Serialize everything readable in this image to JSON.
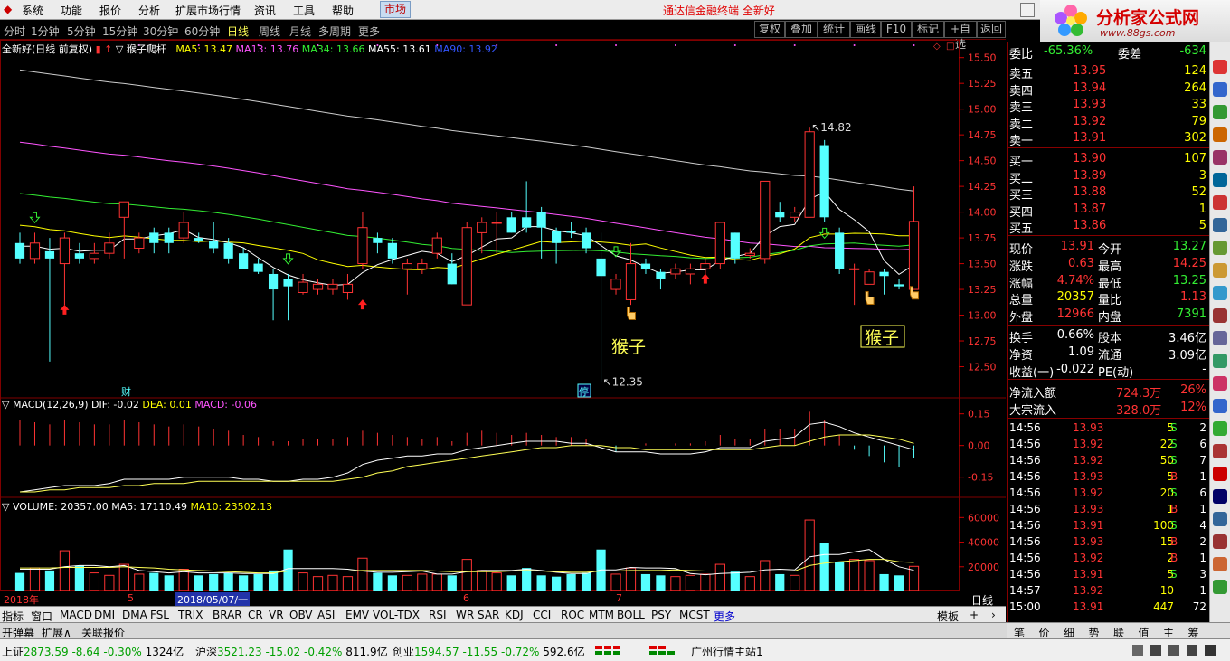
{
  "menubar": {
    "items": [
      "系统",
      "功能",
      "报价",
      "分析",
      "扩展市场行情",
      "资讯",
      "工具",
      "帮助"
    ],
    "market_button": "市场",
    "center_title": "通达信金融终端  全新好",
    "logo_title": "分析家公式网",
    "logo_url": "www.88gs.com"
  },
  "toolbar": {
    "periods": [
      "分时",
      "1分钟",
      "5分钟",
      "15分钟",
      "30分钟",
      "60分钟",
      "日线",
      "周线",
      "月线",
      "多周期",
      "更多"
    ],
    "active_period": "日线",
    "right_buttons": [
      "复权",
      "叠加",
      "统计",
      "画线",
      "F10",
      "标记",
      "+自选",
      "返回"
    ]
  },
  "legend": {
    "stock": "全新好(日线 前复权)",
    "indicator": "猴子爬杆",
    "ma5": "MA5: 13.47",
    "ma13": "MA13: 13.76",
    "ma34": "MA34: 13.66",
    "ma55": "MA55: 13.61",
    "ma90": "MA90: 13.92"
  },
  "macd_legend": {
    "name": "MACD(12,26,9)",
    "dif": "DIF: -0.02",
    "dea": "DEA: 0.01",
    "macd": "MACD: -0.06"
  },
  "vol_legend": {
    "name": "VOLUME: 20357.00",
    "ma5": "MA5: 17110.49",
    "ma10": "MA10: 23502.13"
  },
  "annotations": {
    "high_label": "14.82",
    "low_label": "12.35",
    "monkey1": "猴子",
    "monkey2": "猴子",
    "cai": "财",
    "ting": "停"
  },
  "colors": {
    "up": "#ff3333",
    "down": "#55ffff",
    "ma5": "#ffffff",
    "ma13": "#ffff00",
    "ma34": "#33ee33",
    "ma55": "#ff55ff",
    "ma90": "#cccccc",
    "grid": "#800000"
  },
  "chart_data": {
    "type": "candlestick",
    "price_axis": {
      "ylim": [
        12.25,
        15.55
      ],
      "ticks": [
        "15.50",
        "15.25",
        "15.00",
        "14.75",
        "14.50",
        "14.25",
        "14.00",
        "13.75",
        "13.50",
        "13.25",
        "13.00",
        "12.75",
        "12.50"
      ]
    },
    "macd_axis": {
      "ylim": [
        -0.22,
        0.2
      ],
      "ticks": [
        "0.15",
        "0.00",
        "-0.15"
      ]
    },
    "volume_axis": {
      "ylim": [
        0,
        72000
      ],
      "ticks": [
        "60000",
        "40000",
        "20000"
      ]
    },
    "date_labels": [
      "2018年",
      "5",
      "2018/05/07/一",
      "6",
      "7"
    ],
    "candles": [
      [
        13.7,
        13.55,
        13.8,
        13.5
      ],
      [
        13.55,
        13.7,
        13.8,
        13.5
      ],
      [
        13.62,
        13.55,
        13.75,
        12.55
      ],
      [
        13.5,
        13.75,
        13.8,
        13.1
      ],
      [
        13.6,
        13.55,
        13.7,
        13.5
      ],
      [
        13.55,
        13.6,
        13.7,
        13.5
      ],
      [
        13.6,
        13.7,
        13.8,
        13.55
      ],
      [
        13.95,
        14.1,
        14.1,
        13.55
      ],
      [
        13.65,
        13.75,
        13.8,
        13.6
      ],
      [
        13.8,
        13.7,
        13.85,
        13.6
      ],
      [
        13.8,
        13.7,
        13.85,
        13.6
      ],
      [
        13.75,
        13.9,
        14.0,
        13.7
      ],
      [
        13.75,
        13.72,
        13.8,
        13.7
      ],
      [
        13.72,
        13.65,
        13.9,
        13.6
      ],
      [
        13.7,
        13.55,
        13.75,
        13.5
      ],
      [
        13.6,
        13.45,
        13.65,
        13.45
      ],
      [
        13.5,
        13.42,
        13.55,
        13.4
      ],
      [
        13.4,
        13.25,
        13.45,
        12.95
      ],
      [
        13.35,
        13.28,
        13.4,
        12.95
      ],
      [
        13.22,
        13.32,
        13.4,
        13.2
      ],
      [
        13.25,
        13.3,
        13.35,
        13.2
      ],
      [
        13.25,
        13.3,
        13.35,
        13.2
      ],
      [
        13.22,
        13.3,
        13.4,
        13.15
      ],
      [
        13.5,
        13.85,
        14.0,
        13.45
      ],
      [
        13.75,
        13.7,
        13.8,
        13.6
      ],
      [
        13.7,
        13.55,
        13.75,
        13.5
      ],
      [
        13.45,
        13.5,
        13.55,
        13.2
      ],
      [
        13.45,
        13.5,
        13.55,
        13.4
      ],
      [
        13.6,
        13.75,
        13.8,
        13.55
      ],
      [
        13.5,
        13.3,
        13.6,
        13.3
      ],
      [
        13.1,
        13.85,
        13.9,
        13.1
      ],
      [
        13.8,
        13.9,
        13.95,
        13.6
      ],
      [
        13.9,
        13.9,
        14.0,
        13.6
      ],
      [
        13.95,
        13.8,
        14.0,
        13.8
      ],
      [
        13.95,
        13.85,
        14.3,
        13.8
      ],
      [
        14.0,
        13.85,
        14.05,
        13.55
      ],
      [
        13.82,
        13.7,
        13.85,
        13.5
      ],
      [
        13.82,
        13.8,
        13.9,
        13.75
      ],
      [
        13.8,
        13.65,
        13.85,
        13.6
      ],
      [
        13.55,
        13.38,
        13.8,
        12.35
      ],
      [
        13.25,
        13.35,
        13.4,
        13.2
      ],
      [
        13.15,
        13.5,
        13.7,
        13.1
      ],
      [
        13.5,
        13.45,
        13.55,
        13.4
      ],
      [
        13.42,
        13.35,
        13.45,
        13.25
      ],
      [
        13.4,
        13.45,
        13.5,
        13.35
      ],
      [
        13.4,
        13.45,
        13.5,
        13.3
      ],
      [
        13.45,
        13.5,
        13.55,
        13.4
      ],
      [
        13.5,
        13.9,
        13.9,
        13.45
      ],
      [
        13.8,
        13.55,
        13.8,
        13.5
      ],
      [
        13.58,
        13.6,
        13.65,
        13.55
      ],
      [
        13.55,
        14.3,
        14.3,
        13.5
      ],
      [
        14.0,
        13.95,
        14.1,
        13.9
      ],
      [
        13.95,
        14.0,
        14.05,
        13.9
      ],
      [
        13.95,
        14.78,
        14.82,
        13.95
      ],
      [
        14.65,
        13.95,
        14.7,
        13.9
      ],
      [
        13.8,
        13.45,
        13.85,
        13.4
      ],
      [
        13.45,
        13.45,
        13.5,
        13.1
      ],
      [
        13.3,
        13.42,
        13.45,
        13.3
      ],
      [
        13.42,
        13.38,
        13.45,
        13.2
      ],
      [
        13.3,
        13.28,
        13.35,
        13.25
      ],
      [
        13.25,
        13.91,
        14.25,
        13.25
      ]
    ],
    "macd": [
      0.12,
      0.11,
      0.1,
      0.12,
      0.11,
      0.1,
      0.1,
      0.12,
      0.11,
      0.1,
      0.09,
      0.1,
      0.09,
      0.08,
      0.07,
      0.05,
      0.04,
      0.02,
      0.02,
      0.03,
      0.03,
      0.03,
      0.04,
      0.07,
      0.06,
      0.05,
      0.04,
      0.03,
      0.04,
      0.02,
      0.06,
      0.07,
      0.06,
      0.05,
      0.06,
      0.05,
      0.04,
      0.04,
      0.03,
      0.0,
      -0.03,
      0.0,
      0.01,
      0.0,
      0.01,
      0.01,
      0.02,
      0.05,
      0.03,
      0.03,
      0.08,
      0.08,
      0.08,
      0.16,
      0.12,
      0.05,
      -0.02,
      -0.05,
      -0.08,
      -0.1,
      -0.06
    ],
    "dif": [
      -0.22,
      -0.21,
      -0.2,
      -0.19,
      -0.19,
      -0.19,
      -0.18,
      -0.16,
      -0.16,
      -0.16,
      -0.16,
      -0.15,
      -0.15,
      -0.15,
      -0.15,
      -0.16,
      -0.16,
      -0.17,
      -0.17,
      -0.16,
      -0.16,
      -0.15,
      -0.13,
      -0.09,
      -0.07,
      -0.06,
      -0.05,
      -0.05,
      -0.04,
      -0.04,
      -0.02,
      -0.01,
      0.0,
      0.01,
      0.02,
      0.02,
      0.02,
      0.01,
      0.01,
      -0.01,
      -0.03,
      -0.03,
      -0.03,
      -0.04,
      -0.04,
      -0.04,
      -0.03,
      -0.01,
      -0.01,
      -0.01,
      0.02,
      0.03,
      0.04,
      0.1,
      0.11,
      0.09,
      0.06,
      0.04,
      0.02,
      0.0,
      -0.02
    ],
    "dea": [
      -0.22,
      -0.22,
      -0.21,
      -0.21,
      -0.2,
      -0.2,
      -0.2,
      -0.19,
      -0.19,
      -0.18,
      -0.18,
      -0.18,
      -0.17,
      -0.17,
      -0.17,
      -0.17,
      -0.17,
      -0.17,
      -0.17,
      -0.17,
      -0.17,
      -0.17,
      -0.16,
      -0.15,
      -0.13,
      -0.12,
      -0.1,
      -0.09,
      -0.08,
      -0.07,
      -0.06,
      -0.05,
      -0.04,
      -0.03,
      -0.02,
      -0.01,
      -0.01,
      0.0,
      0.0,
      0.0,
      -0.01,
      -0.01,
      -0.02,
      -0.02,
      -0.02,
      -0.02,
      -0.02,
      -0.02,
      -0.02,
      -0.02,
      -0.01,
      0.0,
      0.0,
      0.02,
      0.04,
      0.05,
      0.05,
      0.05,
      0.04,
      0.03,
      0.01
    ],
    "volume": [
      15000,
      19000,
      17000,
      33000,
      21000,
      15000,
      13000,
      22000,
      14000,
      15000,
      13000,
      18000,
      13000,
      14000,
      15000,
      13000,
      14000,
      17000,
      34000,
      15000,
      12000,
      13000,
      12000,
      27000,
      15000,
      13000,
      13000,
      14000,
      14000,
      13000,
      26000,
      17000,
      15000,
      13000,
      19000,
      13000,
      12000,
      14000,
      15000,
      34000,
      14000,
      19000,
      14000,
      13000,
      12000,
      13000,
      14000,
      22000,
      16000,
      12000,
      25000,
      14000,
      13000,
      58000,
      39000,
      24000,
      26000,
      25000,
      14000,
      13000,
      20357
    ],
    "ma5_vol": [
      18000,
      18000,
      18000,
      20000,
      21000,
      21000,
      20000,
      21000,
      17000,
      16000,
      15000,
      16000,
      15000,
      15000,
      15000,
      14500,
      14500,
      14500,
      18500,
      18500,
      18500,
      18500,
      18000,
      16500,
      15500,
      15500,
      16000,
      16500,
      14000,
      14000,
      16000,
      17000,
      17000,
      17000,
      18000,
      17000,
      15500,
      14500,
      14500,
      17500,
      17500,
      19500,
      19000,
      19000,
      18500,
      14500,
      13500,
      14500,
      15000,
      15500,
      17500,
      18000,
      17500,
      28000,
      30000,
      30000,
      32000,
      34000,
      26000,
      20000,
      17110
    ],
    "ma10_vol": [
      19000,
      19000,
      19000,
      19500,
      19500,
      19500,
      19500,
      20000,
      19500,
      19000,
      18000,
      17500,
      17000,
      16500,
      16000,
      15500,
      15000,
      15000,
      16500,
      16500,
      16500,
      16500,
      16500,
      17000,
      17000,
      17000,
      17000,
      17000,
      16500,
      16000,
      16000,
      16000,
      16000,
      16500,
      17000,
      16500,
      16000,
      15500,
      15500,
      16500,
      16500,
      17000,
      17000,
      17000,
      17500,
      17000,
      16500,
      16500,
      16500,
      16500,
      16500,
      16500,
      16500,
      21000,
      23000,
      24000,
      25000,
      26000,
      26000,
      24000,
      23502
    ]
  },
  "quote": {
    "weibi_label": "委比",
    "weibi": "-65.36%",
    "weicha_label": "委差",
    "weicha": "-634",
    "asks": [
      {
        "label": "卖五",
        "price": "13.95",
        "vol": "124"
      },
      {
        "label": "卖四",
        "price": "13.94",
        "vol": "264"
      },
      {
        "label": "卖三",
        "price": "13.93",
        "vol": "33"
      },
      {
        "label": "卖二",
        "price": "13.92",
        "vol": "79"
      },
      {
        "label": "卖一",
        "price": "13.91",
        "vol": "302"
      }
    ],
    "bids": [
      {
        "label": "买一",
        "price": "13.90",
        "vol": "107"
      },
      {
        "label": "买二",
        "price": "13.89",
        "vol": "3"
      },
      {
        "label": "买三",
        "price": "13.88",
        "vol": "52"
      },
      {
        "label": "买四",
        "price": "13.87",
        "vol": "1"
      },
      {
        "label": "买五",
        "price": "13.86",
        "vol": "5"
      }
    ],
    "stats": [
      {
        "l1": "现价",
        "v1": "13.91",
        "c1": "red",
        "l2": "今开",
        "v2": "13.27",
        "c2": "grn"
      },
      {
        "l1": "涨跌",
        "v1": "0.63",
        "c1": "red",
        "l2": "最高",
        "v2": "14.25",
        "c2": "red"
      },
      {
        "l1": "涨幅",
        "v1": "4.74%",
        "c1": "red",
        "l2": "最低",
        "v2": "13.25",
        "c2": "grn"
      },
      {
        "l1": "总量",
        "v1": "20357",
        "c1": "yel",
        "l2": "量比",
        "v2": "1.13",
        "c2": "red"
      },
      {
        "l1": "外盘",
        "v1": "12966",
        "c1": "red",
        "l2": "内盘",
        "v2": "7391",
        "c2": "grn"
      }
    ],
    "fundamentals": [
      {
        "l1": "换手",
        "v1": "0.66%",
        "l2": "股本",
        "v2": "3.46亿"
      },
      {
        "l1": "净资",
        "v1": "1.09",
        "l2": "流通",
        "v2": "3.09亿"
      },
      {
        "l1": "收益(一)",
        "v1": "-0.022",
        "l2": "PE(动)",
        "v2": "-"
      }
    ],
    "flows": [
      {
        "label": "净流入额",
        "value": "724.3万",
        "pct": "26%"
      },
      {
        "label": "大宗流入",
        "value": "328.0万",
        "pct": "12%"
      }
    ],
    "ticks": [
      {
        "t": "14:56",
        "p": "13.93",
        "v": "5",
        "s": "S",
        "n": "2"
      },
      {
        "t": "14:56",
        "p": "13.92",
        "v": "22",
        "s": "S",
        "n": "6"
      },
      {
        "t": "14:56",
        "p": "13.92",
        "v": "50",
        "s": "S",
        "n": "7"
      },
      {
        "t": "14:56",
        "p": "13.93",
        "v": "5",
        "s": "B",
        "n": "1"
      },
      {
        "t": "14:56",
        "p": "13.92",
        "v": "20",
        "s": "S",
        "n": "6"
      },
      {
        "t": "14:56",
        "p": "13.93",
        "v": "1",
        "s": "B",
        "n": "1"
      },
      {
        "t": "14:56",
        "p": "13.91",
        "v": "100",
        "s": "S",
        "n": "4"
      },
      {
        "t": "14:56",
        "p": "13.93",
        "v": "15",
        "s": "B",
        "n": "2"
      },
      {
        "t": "14:56",
        "p": "13.92",
        "v": "2",
        "s": "B",
        "n": "1"
      },
      {
        "t": "14:56",
        "p": "13.91",
        "v": "5",
        "s": "S",
        "n": "3"
      },
      {
        "t": "14:57",
        "p": "13.92",
        "v": "10",
        "s": "",
        "n": "1"
      },
      {
        "t": "15:00",
        "p": "13.91",
        "v": "447",
        "s": "",
        "n": "72"
      }
    ]
  },
  "indicators": [
    "指标",
    "窗口",
    "MACD",
    "DMI",
    "DMA",
    "FSL",
    "TRIX",
    "BRAR",
    "CR",
    "VR",
    "OBV",
    "ASI",
    "EMV",
    "VOL-TDX",
    "RSI",
    "WR",
    "SAR",
    "KDJ",
    "CCI",
    "ROC",
    "MTM",
    "BOLL",
    "PSY",
    "MCST",
    "更多"
  ],
  "template_label": "模板",
  "period_label": "日线",
  "bottom_tabs": [
    "开弹幕",
    "扩展∧",
    "关联报价"
  ],
  "right_tabs": [
    "笔",
    "价",
    "细",
    "势",
    "联",
    "值",
    "主",
    "筹"
  ],
  "status": {
    "sh": "上证",
    "sh_val": "2873.59",
    "sh_chg": "-8.64",
    "sh_pct": "-0.30%",
    "sh_amt": "1324亿",
    "sz": "沪深",
    "sz_val": "3521.23",
    "sz_chg": "-15.02",
    "sz_pct": "-0.42%",
    "sz_amt": "811.9亿",
    "cy": "创业",
    "cy_val": "1594.57",
    "cy_chg": "-11.55",
    "cy_pct": "-0.72%",
    "cy_amt": "592.6亿",
    "server": "广州行情主站1"
  }
}
